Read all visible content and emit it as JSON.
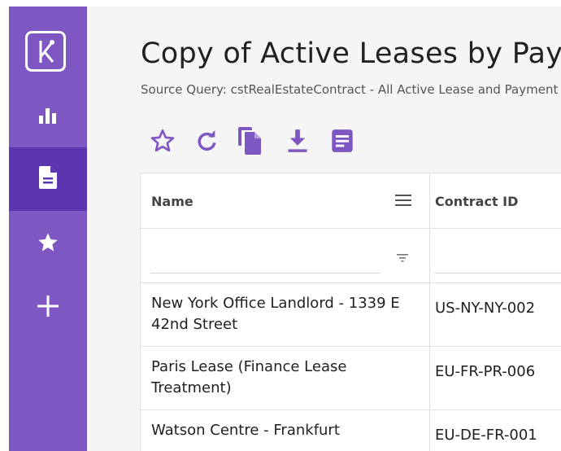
{
  "sidebar": {
    "items": [
      {
        "icon": "logo-icon"
      },
      {
        "icon": "bar-chart-icon"
      },
      {
        "icon": "document-icon",
        "active": true
      },
      {
        "icon": "star-icon"
      },
      {
        "icon": "plus-icon"
      }
    ]
  },
  "page": {
    "title": "Copy of Active Leases by Payment",
    "subtitle": "Source Query: cstRealEstateContract - All Active Lease and Payment"
  },
  "toolbar": {
    "icons": [
      "star-outline-icon",
      "refresh-icon",
      "copy-icon",
      "download-icon",
      "notes-icon"
    ]
  },
  "table": {
    "columns": [
      {
        "label": "Name"
      },
      {
        "label": "Contract ID"
      }
    ],
    "rows": [
      {
        "name_line1": "New York Office Landlord - 1339 E",
        "name_line2": "42nd Street",
        "contract_id": "US-NY-NY-002"
      },
      {
        "name_line1": "Paris Lease (Finance Lease",
        "name_line2": "Treatment)",
        "contract_id": "EU-FR-PR-006"
      },
      {
        "name_line1": "Watson Centre - Frankfurt",
        "name_line2": "",
        "contract_id": "EU-DE-FR-001"
      }
    ]
  },
  "colors": {
    "sidebar": "#7e57c2",
    "sidebar_active": "#5e35b1",
    "accent": "#7e57c2"
  }
}
